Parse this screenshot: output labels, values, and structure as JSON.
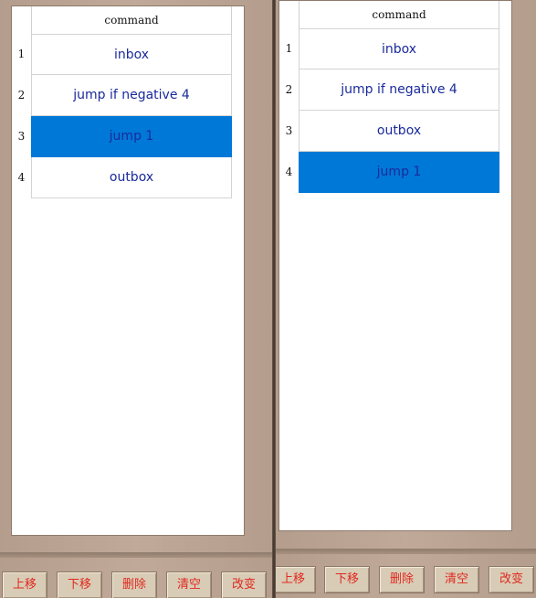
{
  "left_panel": {
    "header": "command",
    "rows": [
      {
        "num": "1",
        "command": "inbox"
      },
      {
        "num": "2",
        "command": "jump if negative 4"
      },
      {
        "num": "3",
        "command": "jump 1"
      },
      {
        "num": "4",
        "command": "outbox"
      }
    ],
    "selected_row": 3,
    "buttons": {
      "move_up": "上移",
      "move_down": "下移",
      "delete": "删除",
      "clear": "清空",
      "change": "改变"
    }
  },
  "right_panel": {
    "header": "command",
    "rows": [
      {
        "num": "1",
        "command": "inbox"
      },
      {
        "num": "2",
        "command": "jump if negative 4"
      },
      {
        "num": "3",
        "command": "outbox"
      },
      {
        "num": "4",
        "command": "jump 1"
      }
    ],
    "selected_row": 4,
    "buttons": {
      "move_up": "上移",
      "move_down": "下移",
      "delete": "删除",
      "clear": "清空",
      "change": "改变"
    }
  },
  "colors": {
    "selection": "#0078d7",
    "command_text": "#1a2a9c",
    "button_text": "#e0281e",
    "button_face": "#d9ccb6",
    "background": "#b69f8e"
  }
}
